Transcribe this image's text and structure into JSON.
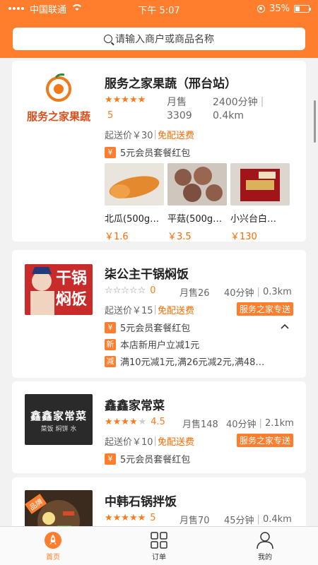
{
  "status_bar": {
    "carrier": "中国联通",
    "time": "下午 5:07",
    "battery": "35%"
  },
  "search": {
    "placeholder": "请输入商户或商品名称"
  },
  "stores": [
    {
      "name": "服务之家果蔬（邢台站）",
      "logo_text": "服务之家果蔬",
      "rating": "5",
      "monthly_sales_label": "月售",
      "monthly_sales": "3309",
      "time": "2400分钟",
      "distance": "0.4km",
      "min_order": "起送价￥30",
      "free_delivery": "免配送费",
      "promo": "5元会员套餐红包",
      "promo_badge": "¥",
      "products": [
        {
          "name": "北瓜(500g…",
          "price": "￥1.6"
        },
        {
          "name": "平菇(500g…",
          "price": "￥3.5"
        },
        {
          "name": "小兴台白…",
          "price": "￥130"
        }
      ]
    },
    {
      "name": "柒公主干锅焖饭",
      "rating": "0",
      "monthly_sales": "月售26",
      "time": "40分钟",
      "distance": "0.3km",
      "min_order": "起送价￥15",
      "free_delivery": "免配送费",
      "delivery_tag": "服务之家专送",
      "promos": [
        {
          "badge": "¥",
          "text": "5元会员套餐红包"
        },
        {
          "badge": "新",
          "text": "本店新用户立减1元"
        },
        {
          "badge": "减",
          "text": "满10元减1元,满26元减2元,满48…"
        }
      ],
      "image_text": "干锅焖饭"
    },
    {
      "name": "鑫鑫家常菜",
      "rating": "4.5",
      "monthly_sales": "月售148",
      "time": "40分钟",
      "distance": "2.1km",
      "min_order": "起送价￥10",
      "free_delivery": "免配送费",
      "delivery_tag": "服务之家专送",
      "promo": "5元会员套餐红包",
      "promo_badge": "¥",
      "image_text": "鑫鑫家常菜",
      "image_subtext": "菜饭  焖饼  水"
    },
    {
      "name": "中韩石锅拌饭",
      "rating": "5",
      "monthly_sales": "月售70",
      "time": "45分钟",
      "distance": "0.4km",
      "image_badge": "品牌"
    }
  ],
  "tabs": [
    {
      "label": "首页",
      "icon": "rocket-icon"
    },
    {
      "label": "订单",
      "icon": "grid-icon"
    },
    {
      "label": "我的",
      "icon": "person-icon"
    }
  ],
  "colors": {
    "accent": "#ff7e2d",
    "price": "#ff6a00"
  }
}
